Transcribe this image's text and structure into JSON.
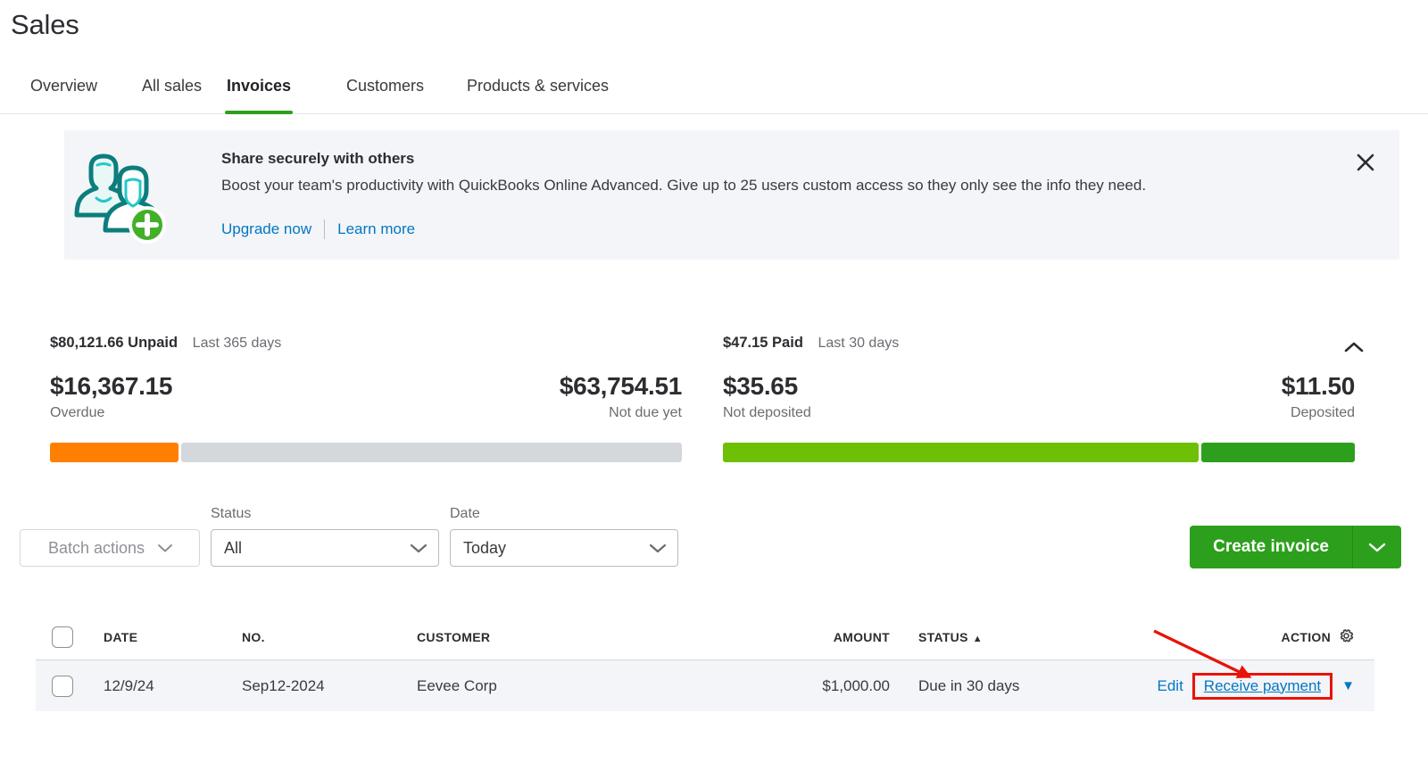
{
  "header": {
    "title": "Sales",
    "tabs": [
      {
        "label": "Overview",
        "active": false
      },
      {
        "label": "All sales",
        "active": false
      },
      {
        "label": "Invoices",
        "active": true
      },
      {
        "label": "Customers",
        "active": false
      },
      {
        "label": "Products & services",
        "active": false
      }
    ]
  },
  "banner": {
    "icon": "two-people-add-icon",
    "title": "Share securely with others",
    "body": "Boost your team's productivity with QuickBooks Online Advanced. Give up to 25 users custom access so they only see the info they need.",
    "upgrade_link": "Upgrade now",
    "learn_link": "Learn more",
    "close_icon": "close-icon"
  },
  "summary": {
    "collapse_icon": "chevron-up-icon",
    "unpaid": {
      "total": "$80,121.66 Unpaid",
      "total_amount": "$80,121.66",
      "total_word": "Unpaid",
      "range": "Last 365 days",
      "left_value": "$16,367.15",
      "left_label": "Overdue",
      "right_value": "$63,754.51",
      "right_label": "Not due yet",
      "left_pct": 20.4,
      "right_pct": 79.6,
      "left_color": "#ff8000",
      "right_color": "#d4d7dc"
    },
    "paid": {
      "total": "$47.15 Paid",
      "total_amount": "$47.15",
      "total_word": "Paid",
      "range": "Last 30 days",
      "left_value": "$35.65",
      "left_label": "Not deposited",
      "right_value": "$11.50",
      "right_label": "Deposited",
      "left_pct": 75.6,
      "right_pct": 24.4,
      "left_color": "#6dc005",
      "right_color": "#2ca01c"
    }
  },
  "toolbar": {
    "batch_actions": "Batch actions",
    "status_label": "Status",
    "status_value": "All",
    "date_label": "Date",
    "date_value": "Today",
    "create_invoice": "Create invoice",
    "caret_icon": "chevron-down-icon"
  },
  "table": {
    "columns": {
      "date": "DATE",
      "no": "NO.",
      "customer": "CUSTOMER",
      "amount": "AMOUNT",
      "status": "STATUS",
      "status_sort": "▲",
      "action": "ACTION",
      "gear_icon": "gear-icon"
    },
    "rows": [
      {
        "date": "12/9/24",
        "no": "Sep12-2024",
        "customer": "Eevee Corp",
        "amount": "$1,000.00",
        "status": "Due in 30 days",
        "edit": "Edit",
        "receive_payment": "Receive payment",
        "caret": "▼"
      }
    ]
  },
  "annotation": {
    "highlight_color": "#e81309",
    "highlight_target": "Receive payment"
  }
}
